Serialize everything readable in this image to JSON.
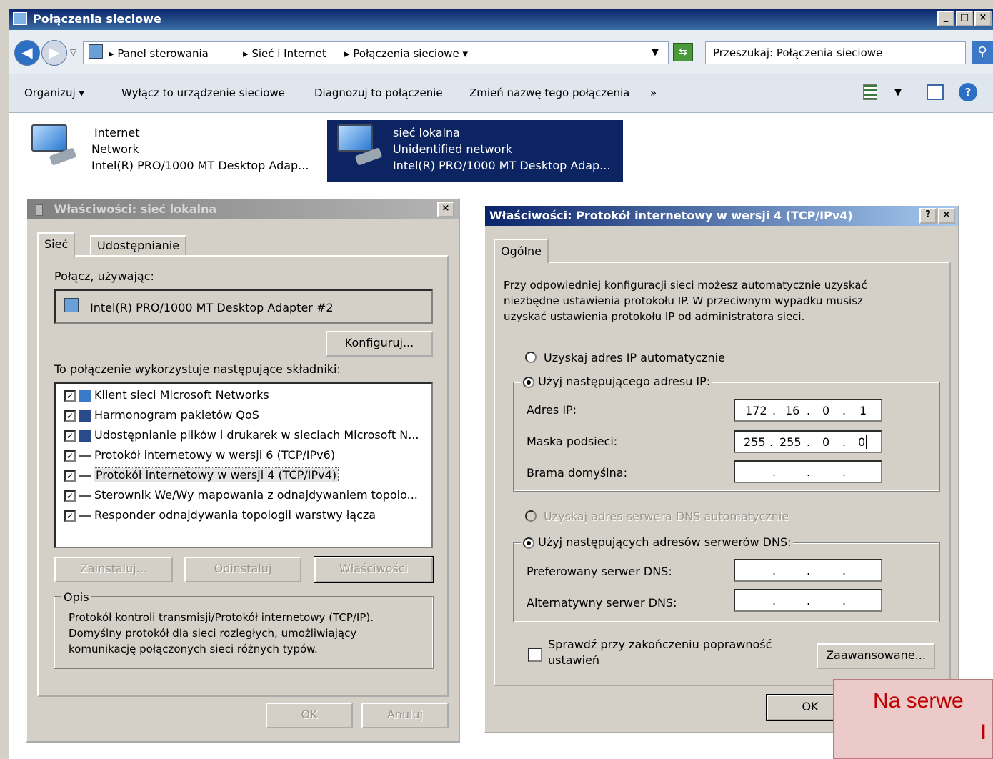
{
  "window": {
    "title": "Połączenia sieciowe",
    "min": "_",
    "max": "□",
    "close": "×"
  },
  "address": {
    "crumbs": [
      "Panel sterowania",
      "Sieć i Internet",
      "Połączenia sieciowe"
    ],
    "search_placeholder": "Przeszukaj: Połączenia sieciowe"
  },
  "toolbar": {
    "organize": "Organizuj",
    "disable": "Wyłącz to urządzenie sieciowe",
    "diagnose": "Diagnozuj to połączenie",
    "rename": "Zmień nazwę tego połączenia",
    "more": "»"
  },
  "connections": [
    {
      "name": "Internet",
      "status": "Network",
      "adapter": "Intel(R) PRO/1000 MT Desktop Adap..."
    },
    {
      "name": "sieć lokalna",
      "status": "Unidentified network",
      "adapter": "Intel(R) PRO/1000 MT Desktop Adap..."
    }
  ],
  "props": {
    "title": "Właściwości: sieć lokalna",
    "close": "×",
    "tabs": [
      "Sieć",
      "Udostępnianie"
    ],
    "connect_using": "Połącz, używając:",
    "adapter": "Intel(R) PRO/1000 MT Desktop Adapter #2",
    "configure": "Konfiguruj...",
    "components_label": "To połączenie wykorzystuje następujące składniki:",
    "components": [
      "Klient sieci Microsoft Networks",
      "Harmonogram pakietów QoS",
      "Udostępnianie plików i drukarek w sieciach Microsoft N...",
      "Protokół internetowy w wersji 6 (TCP/IPv6)",
      "Protokół internetowy w wersji 4 (TCP/IPv4)",
      "Sterownik We/Wy mapowania z odnajdywaniem topolo...",
      "Responder odnajdywania topologii warstwy łącza"
    ],
    "install": "Zainstaluj...",
    "uninstall": "Odinstaluj",
    "properties": "Właściwości",
    "desc_legend": "Opis",
    "description": [
      "Protokół kontroli transmisji/Protokół internetowy (TCP/IP).",
      "Domyślny protokół dla sieci rozległych, umożliwiający",
      "komunikację połączonych sieci różnych typów."
    ],
    "ok": "OK",
    "cancel": "Anuluj"
  },
  "ipv4": {
    "title": "Właściwości: Protokół internetowy w wersji 4 (TCP/IPv4)",
    "help": "?",
    "close": "×",
    "tab": "Ogólne",
    "intro": [
      "Przy odpowiedniej konfiguracji sieci możesz automatycznie uzyskać",
      "niezbędne ustawienia protokołu IP. W przeciwnym wypadku musisz",
      "uzyskać ustawienia protokołu IP od administratora sieci."
    ],
    "auto_ip": "Uzyskaj adres IP automatycznie",
    "use_ip": "Użyj następującego adresu IP:",
    "ip_label": "Adres IP:",
    "ip": [
      "172",
      "16",
      "0",
      "1"
    ],
    "mask_label": "Maska podsieci:",
    "mask": [
      "255",
      "255",
      "0",
      "0"
    ],
    "gw_label": "Brama domyślna:",
    "auto_dns": "Uzyskaj adres serwera DNS automatycznie",
    "use_dns": "Użyj następujących adresów serwerów DNS:",
    "pref_dns": "Preferowany serwer DNS:",
    "alt_dns": "Alternatywny serwer DNS:",
    "validate": [
      "Sprawdź przy zakończeniu poprawność",
      "ustawień"
    ],
    "advanced": "Zaawansowane...",
    "ok": "OK"
  },
  "callout": "Na serwe",
  "callout2": "I"
}
